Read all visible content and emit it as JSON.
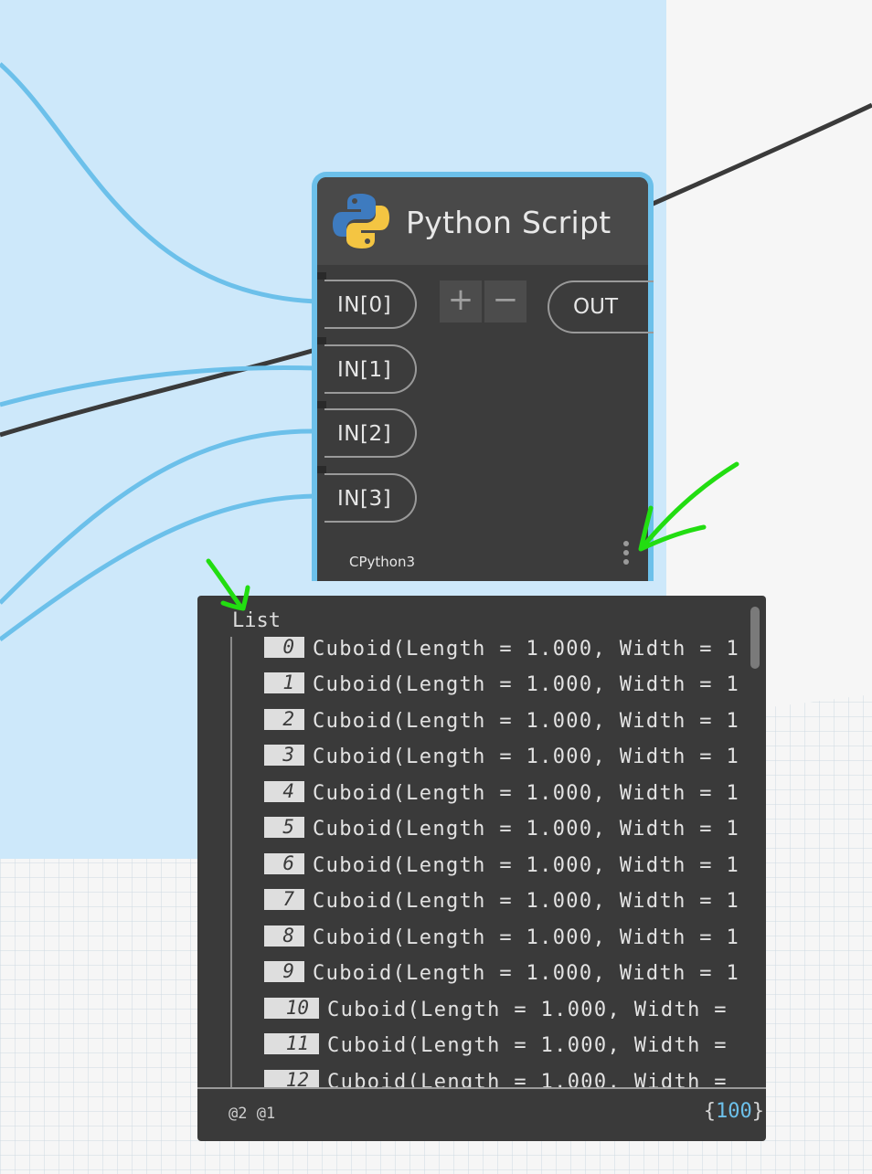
{
  "colors": {
    "canvas_selected": "#cde8fa",
    "canvas_background": "#f6f6f6",
    "wire_active": "#6cc0ea",
    "wire_dark": "#3a3a3a",
    "node_body": "#3c3c3c",
    "node_header": "#494949",
    "node_border_selected": "#6cc0ea",
    "annotation": "#22dd11",
    "count_value": "#6cc0ea"
  },
  "node": {
    "title": "Python Script",
    "icon": "python-logo-icon",
    "inputs": [
      "IN[0]",
      "IN[1]",
      "IN[2]",
      "IN[3]"
    ],
    "add_label": "+",
    "remove_label": "−",
    "output": "OUT",
    "engine": "CPython3",
    "menu_icon": "kebab-menu-icon"
  },
  "preview": {
    "header": "List",
    "rows": [
      {
        "index": "0",
        "text": "Cuboid(Length = 1.000, Width = 1"
      },
      {
        "index": "1",
        "text": "Cuboid(Length = 1.000, Width = 1"
      },
      {
        "index": "2",
        "text": "Cuboid(Length = 1.000, Width = 1"
      },
      {
        "index": "3",
        "text": "Cuboid(Length = 1.000, Width = 1"
      },
      {
        "index": "4",
        "text": "Cuboid(Length = 1.000, Width = 1"
      },
      {
        "index": "5",
        "text": "Cuboid(Length = 1.000, Width = 1"
      },
      {
        "index": "6",
        "text": "Cuboid(Length = 1.000, Width = 1"
      },
      {
        "index": "7",
        "text": "Cuboid(Length = 1.000, Width = 1"
      },
      {
        "index": "8",
        "text": "Cuboid(Length = 1.000, Width = 1"
      },
      {
        "index": "9",
        "text": "Cuboid(Length = 1.000, Width = 1"
      },
      {
        "index": "10",
        "text": "Cuboid(Length = 1.000, Width ="
      },
      {
        "index": "11",
        "text": "Cuboid(Length = 1.000, Width ="
      },
      {
        "index": "12",
        "text": "Cuboid(Length = 1.000, Width ="
      }
    ],
    "levels": "@2 @1",
    "count_open": "{",
    "count": "100",
    "count_close": "}"
  }
}
